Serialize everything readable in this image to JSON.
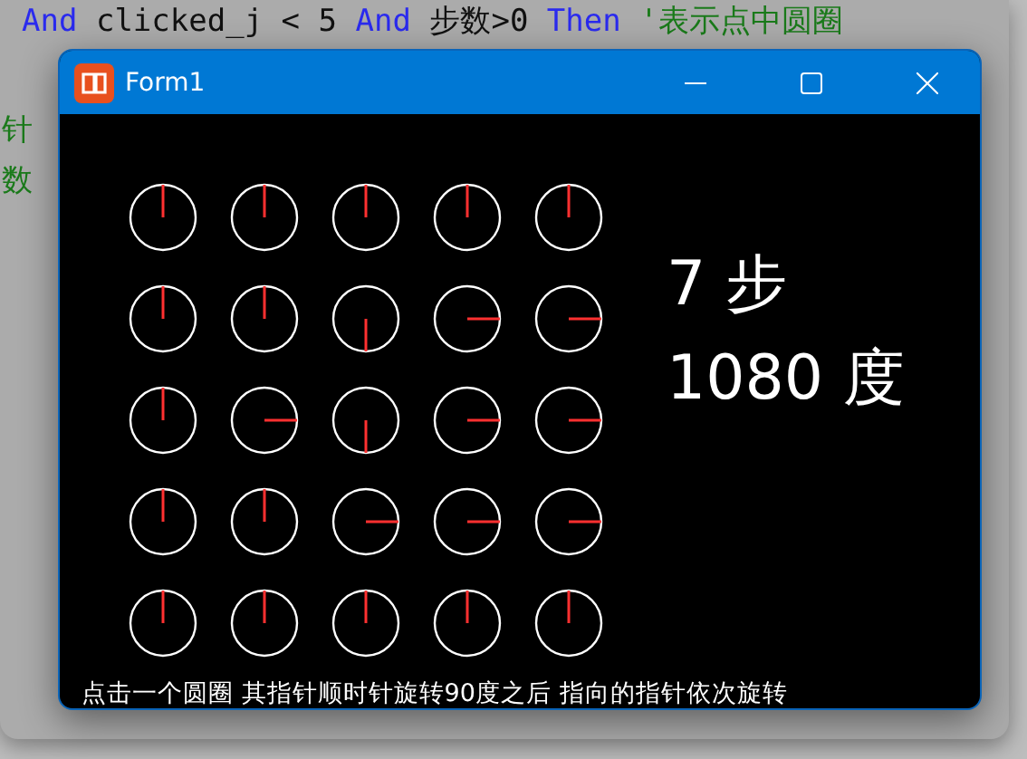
{
  "editor": {
    "lines": [
      {
        "text": "And clicked_j < 5 And 步数>0 Then '表示点中圆圈"
      },
      {
        "text": "针"
      },
      {
        "text": "数"
      }
    ]
  },
  "window": {
    "title": "Form1"
  },
  "grid": {
    "rows": [
      {
        "dials": [
          {
            "kind": "up"
          },
          {
            "kind": "up"
          },
          {
            "kind": "up"
          },
          {
            "kind": "up"
          },
          {
            "kind": "up"
          }
        ]
      },
      {
        "dials": [
          {
            "kind": "up"
          },
          {
            "kind": "up"
          },
          {
            "kind": "down"
          },
          {
            "kind": "right"
          },
          {
            "kind": "right"
          }
        ]
      },
      {
        "dials": [
          {
            "kind": "up"
          },
          {
            "kind": "right"
          },
          {
            "kind": "down"
          },
          {
            "kind": "right"
          },
          {
            "kind": "right"
          }
        ]
      },
      {
        "dials": [
          {
            "kind": "up"
          },
          {
            "kind": "up"
          },
          {
            "kind": "right"
          },
          {
            "kind": "right"
          },
          {
            "kind": "right"
          }
        ]
      },
      {
        "dials": [
          {
            "kind": "up"
          },
          {
            "kind": "up"
          },
          {
            "kind": "up"
          },
          {
            "kind": "up"
          },
          {
            "kind": "up"
          }
        ]
      }
    ]
  },
  "steps": "7 步",
  "degrees": "1080 度",
  "hint": "点击一个圆圈 其指针顺时针旋转90度之后 指向的指针依次旋转"
}
